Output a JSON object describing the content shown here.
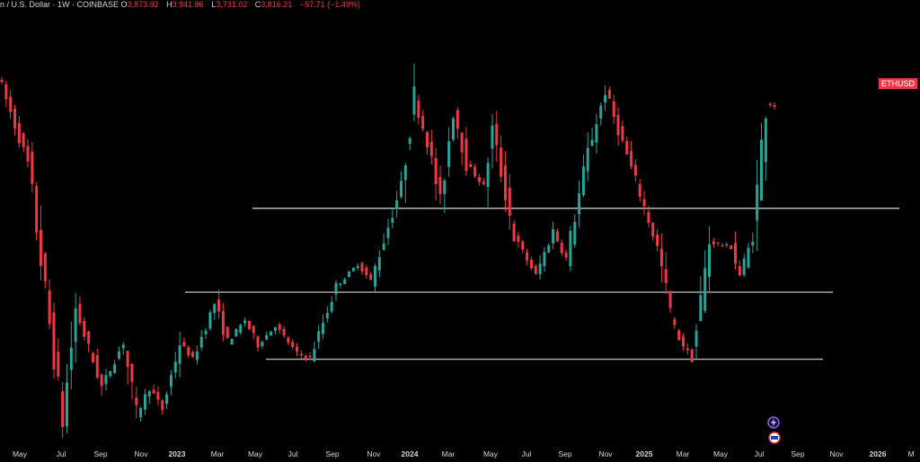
{
  "header": {
    "symbol_text": "n / U.S. Dollar · 1W · COINBASE",
    "open_label": "O",
    "open": "3,873.92",
    "high_label": "H",
    "high": "3,941.86",
    "low_label": "L",
    "low": "3,731.02",
    "close_label": "C",
    "close": "3,816.21",
    "change": "−57.71 (−1.49%)"
  },
  "price_badge": "ETHUSD",
  "colors": {
    "up": "#26a69a",
    "down": "#f23645",
    "background": "#000000",
    "line": "#d9d9d9",
    "text": "#d1d4dc"
  },
  "chart_data": {
    "type": "candlestick",
    "symbol": "ETHUSD",
    "interval": "1W",
    "exchange": "COINBASE",
    "x_tick_labels": [
      {
        "label": "May"
      },
      {
        "label": "Jul"
      },
      {
        "label": "Sep"
      },
      {
        "label": "Nov"
      },
      {
        "label": "2023",
        "bold": true
      },
      {
        "label": "Mar"
      },
      {
        "label": "May"
      },
      {
        "label": "Jul"
      },
      {
        "label": "Sep"
      },
      {
        "label": "Nov"
      },
      {
        "label": "2024",
        "bold": true
      },
      {
        "label": "Mar"
      },
      {
        "label": "May"
      },
      {
        "label": "Jul"
      },
      {
        "label": "Sep"
      },
      {
        "label": "Nov"
      },
      {
        "label": "2025",
        "bold": true
      },
      {
        "label": "Mar"
      },
      {
        "label": "May"
      },
      {
        "label": "Jul"
      },
      {
        "label": "Sep"
      },
      {
        "label": "Nov"
      },
      {
        "label": "2026",
        "bold": true
      },
      {
        "label": "M"
      }
    ],
    "horizontal_lines": [
      {
        "price": 2900,
        "from": "2022-09",
        "to": "2025-10"
      },
      {
        "price": 2150,
        "from": "2022-11",
        "to": "2025-10"
      },
      {
        "price": 1550,
        "from": "2023-01",
        "to": "2025-10"
      }
    ],
    "ylim": [
      800,
      4200
    ],
    "segments": [
      [
        4100,
        3300,
        7
      ],
      [
        3300,
        1000,
        8
      ],
      [
        1000,
        2000,
        3
      ],
      [
        2000,
        1300,
        6
      ],
      [
        1300,
        1700,
        5
      ],
      [
        1700,
        1050,
        3
      ],
      [
        1050,
        1300,
        3
      ],
      [
        1300,
        1100,
        3
      ],
      [
        1100,
        1700,
        4
      ],
      [
        1700,
        1550,
        3
      ],
      [
        1550,
        2050,
        5
      ],
      [
        2050,
        1700,
        3
      ],
      [
        1700,
        1900,
        4
      ],
      [
        1900,
        1680,
        3
      ],
      [
        1680,
        1850,
        4
      ],
      [
        1850,
        1600,
        5
      ],
      [
        1600,
        1560,
        3
      ],
      [
        1560,
        2200,
        6
      ],
      [
        2200,
        2400,
        5
      ],
      [
        2400,
        2250,
        3
      ],
      [
        2250,
        3100,
        7
      ],
      [
        3100,
        3900,
        3
      ],
      [
        3900,
        3500,
        3
      ],
      [
        3500,
        2950,
        3
      ],
      [
        2950,
        3800,
        3
      ],
      [
        3800,
        3300,
        3
      ],
      [
        3300,
        3100,
        4
      ],
      [
        3100,
        3600,
        2
      ],
      [
        3600,
        2650,
        5
      ],
      [
        2650,
        2300,
        5
      ],
      [
        2300,
        2700,
        4
      ],
      [
        2700,
        2450,
        3
      ],
      [
        2450,
        3400,
        5
      ],
      [
        3400,
        3950,
        4
      ],
      [
        3950,
        3600,
        3
      ],
      [
        3600,
        3150,
        4
      ],
      [
        3150,
        2550,
        5
      ],
      [
        2550,
        1800,
        4
      ],
      [
        1800,
        1550,
        4
      ],
      [
        1550,
        2600,
        4
      ],
      [
        2600,
        2550,
        5
      ],
      [
        2550,
        2300,
        2
      ],
      [
        2300,
        2650,
        3
      ],
      [
        2650,
        3850,
        3
      ],
      [
        3850,
        3816,
        2
      ]
    ]
  }
}
